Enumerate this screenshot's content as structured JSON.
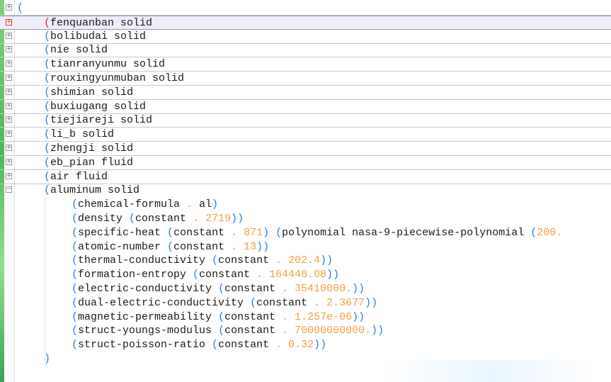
{
  "editor": {
    "root_paren": "(",
    "materials": [
      {
        "name": "fenquanban",
        "kind": "solid",
        "current": true
      },
      {
        "name": "bolibudai",
        "kind": "solid"
      },
      {
        "name": "nie",
        "kind": "solid"
      },
      {
        "name": "tianranyunmu",
        "kind": "solid"
      },
      {
        "name": "rouxingyunmuban",
        "kind": "solid"
      },
      {
        "name": "shimian",
        "kind": "solid"
      },
      {
        "name": "buxiugang",
        "kind": "solid"
      },
      {
        "name": "tiejiareji",
        "kind": "solid"
      },
      {
        "name": "li_b",
        "kind": "solid"
      },
      {
        "name": "zhengji",
        "kind": "solid"
      },
      {
        "name": "eb_pian",
        "kind": "fluid"
      },
      {
        "name": "air",
        "kind": "fluid"
      }
    ],
    "expanded": {
      "name": "aluminum",
      "kind": "solid",
      "properties": [
        {
          "key": "chemical-formula",
          "type": "",
          "value": "al"
        },
        {
          "key": "density",
          "type": "constant",
          "value": "2719"
        },
        {
          "key": "specific-heat",
          "type": "constant",
          "value": "871",
          "extra": "(polynomial nasa-9-piecewise-polynomial (200."
        },
        {
          "key": "atomic-number",
          "type": "constant",
          "value": "13"
        },
        {
          "key": "thermal-conductivity",
          "type": "constant",
          "value": "202.4"
        },
        {
          "key": "formation-entropy",
          "type": "constant",
          "value": "164448.08"
        },
        {
          "key": "electric-conductivity",
          "type": "constant",
          "value": "35410000."
        },
        {
          "key": "dual-electric-conductivity",
          "type": "constant",
          "value": "2.3677"
        },
        {
          "key": "magnetic-permeability",
          "type": "constant",
          "value": "1.257e-06"
        },
        {
          "key": "struct-youngs-modulus",
          "type": "constant",
          "value": "70000000000."
        },
        {
          "key": "struct-poisson-ratio",
          "type": "constant",
          "value": "0.32"
        }
      ],
      "closing": ")"
    },
    "icons": {
      "collapsed": "plus-box",
      "expanded": "minus-box"
    },
    "colors": {
      "paren": "#2980d9",
      "number": "#f0a040",
      "current_line": "#ededfa",
      "current_marker": "#d22a2a"
    }
  }
}
